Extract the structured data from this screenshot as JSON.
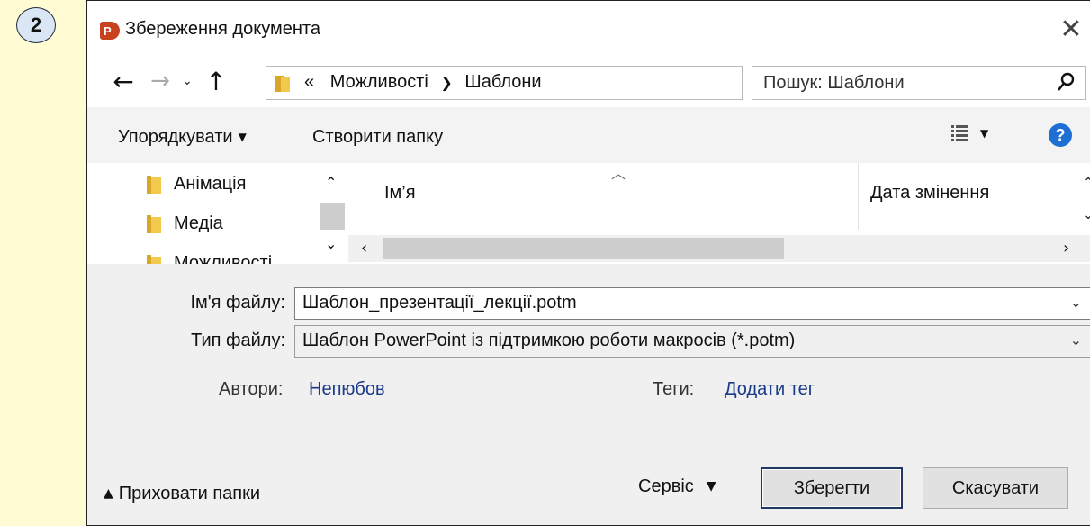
{
  "step_badge": "2",
  "dialog": {
    "title": "Збереження документа",
    "app_icon_letter": "P"
  },
  "nav": {
    "path_prefix": "«",
    "path_parts": [
      "Можливості",
      "Шаблони"
    ],
    "search_placeholder": "Пошук: Шаблони"
  },
  "toolbar": {
    "organize": "Упорядкувати",
    "new_folder": "Створити папку",
    "help": "?"
  },
  "nav_pane": {
    "items": [
      "Анімація",
      "Медіа",
      "Можливості"
    ]
  },
  "file_list": {
    "columns": [
      "Ім’я",
      "Дата змінення"
    ]
  },
  "form": {
    "file_name_label": "Ім'я файлу:",
    "file_name_value": "Шаблон_презентації_лекції.potm",
    "file_type_label": "Тип файлу:",
    "file_type_value": "Шаблон PowerPoint із підтримкою роботи макросів (*.potm)",
    "authors_label": "Автори:",
    "authors_value": "Непюбов",
    "tags_label": "Теги:",
    "tags_value": "Додати тег"
  },
  "footer": {
    "hide_folders": "Приховати папки",
    "service": "Сервіс",
    "save": "Зберегти",
    "cancel": "Скасувати"
  },
  "colors": {
    "page_bg": "#fffbd2",
    "arrow": "#1a2a9c",
    "accent": "#1d6fd3",
    "app_icon": "#c8421e"
  }
}
